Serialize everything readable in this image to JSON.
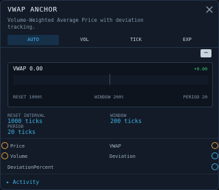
{
  "panel": {
    "title": "VWAP ANCHOR",
    "description": "Volume-Weighted Average Price with deviation tracking."
  },
  "tabs": [
    {
      "label": "AUTO",
      "active": true
    },
    {
      "label": "VOL",
      "active": false
    },
    {
      "label": "TICK",
      "active": false
    },
    {
      "label": "EXP",
      "active": false
    }
  ],
  "collapse_button": {
    "label": "−"
  },
  "chart": {
    "value_label": "VWAP 0.00",
    "delta": "+0.00",
    "reset": "RESET 1000t",
    "window": "WINDOW 200t",
    "period": "PERIOD 20"
  },
  "stats": {
    "reset_interval": {
      "label": "RESET INTERVAL",
      "value": "1000 ticks"
    },
    "window": {
      "label": "WINDOW",
      "value": "200 ticks"
    },
    "period": {
      "label": "PERIOD",
      "value": "20 ticks"
    }
  },
  "ports": {
    "inputs": [
      {
        "label": "Price",
        "color": "#e8a23a"
      },
      {
        "label": "Volume",
        "color": "#e8a23a"
      },
      {
        "label": "DeviationPercent",
        "color": ""
      }
    ],
    "outputs": [
      {
        "label": "VWAP",
        "color": "#e8a23a"
      },
      {
        "label": "Deviation",
        "color": "#3fb2ea"
      },
      {
        "label": "",
        "color": "#3fb2ea"
      }
    ]
  },
  "activity": {
    "label": "▸ Activity"
  }
}
